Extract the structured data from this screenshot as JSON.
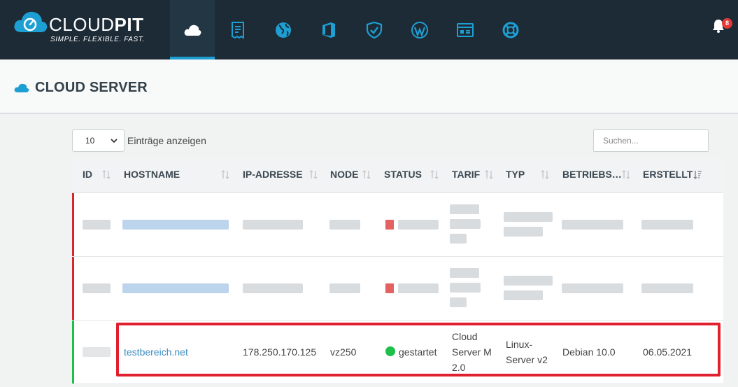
{
  "brand": {
    "name_light": "CLOUD",
    "name_bold": "PIT",
    "tagline": "SIMPLE. FLEXIBLE. FAST."
  },
  "nav": {
    "items": [
      {
        "icon": "cloud-icon",
        "active": true
      },
      {
        "icon": "invoice-icon",
        "active": false
      },
      {
        "icon": "globe-icon",
        "active": false
      },
      {
        "icon": "office-icon",
        "active": false
      },
      {
        "icon": "shield-icon",
        "active": false
      },
      {
        "icon": "wordpress-icon",
        "active": false
      },
      {
        "icon": "window-icon",
        "active": false
      },
      {
        "icon": "lifebuoy-icon",
        "active": false
      }
    ],
    "notifications_count": "8"
  },
  "page": {
    "title": "CLOUD SERVER"
  },
  "controls": {
    "entries_value": "10",
    "entries_label": "Einträge anzeigen",
    "search_placeholder": "Suchen..."
  },
  "table": {
    "headers": [
      "ID",
      "HOSTNAME",
      "IP-ADRESSE",
      "NODE",
      "STATUS",
      "TARIF",
      "TYP",
      "BETRIEBS…",
      "ERSTELLT"
    ],
    "rows": [
      {
        "status": "stopped",
        "redacted": true
      },
      {
        "status": "stopped",
        "redacted": true
      },
      {
        "status": "started",
        "redacted": false,
        "hostname": "testbereich.net",
        "ip": "178.250.170.125",
        "node": "vz250",
        "status_label": "gestartet",
        "tarif": [
          "Cloud",
          "Server M",
          "2.0"
        ],
        "typ": [
          "Linux-",
          "Server v2"
        ],
        "os": "Debian 10.0",
        "created": "06.05.2021"
      }
    ]
  },
  "colors": {
    "topbar": "#1c2b36",
    "accent": "#1e9fd3",
    "stopped": "#d9262f",
    "started": "#1fc04a",
    "link": "#3d8cc2",
    "highlight": "#e0202e"
  }
}
